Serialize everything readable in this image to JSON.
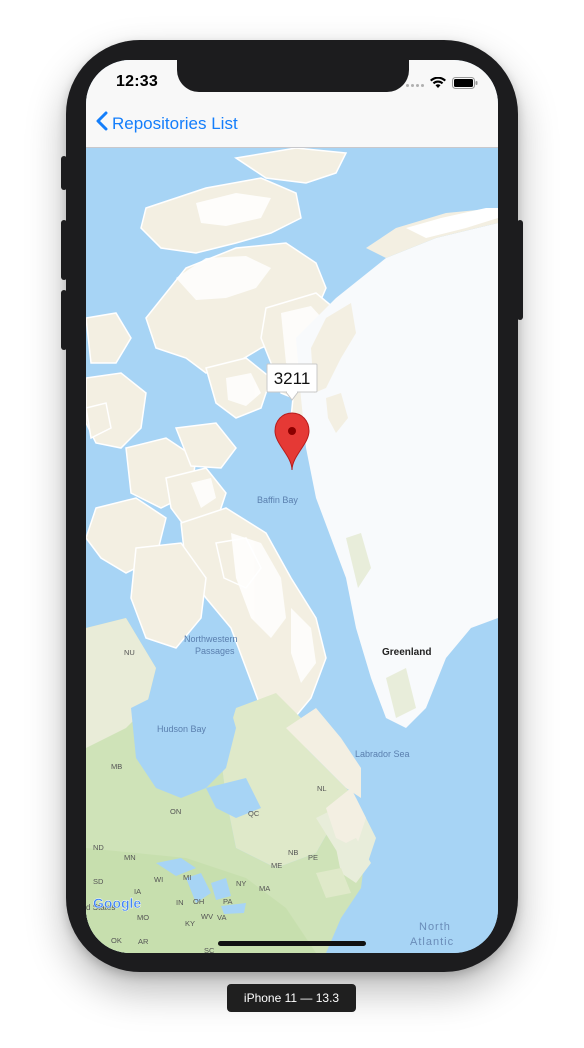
{
  "status_bar": {
    "time": "12:33"
  },
  "nav": {
    "back_label": "Repositories List"
  },
  "map": {
    "callout": "3211",
    "labels": {
      "baffin_bay": "Baffin Bay",
      "northwestern_1": "Northwestern",
      "northwestern_2": "Passages",
      "nu": "NU",
      "greenland": "Greenland",
      "hudson_bay": "Hudson Bay",
      "labrador_sea": "Labrador Sea",
      "mb": "MB",
      "on": "ON",
      "qc": "QC",
      "nl": "NL",
      "nd": "ND",
      "mn": "MN",
      "wi": "WI",
      "me": "ME",
      "nb": "NB",
      "pe": "PE",
      "sd": "SD",
      "ia": "IA",
      "mi": "MI",
      "ny": "NY",
      "ma": "MA",
      "in": "IN",
      "oh": "OH",
      "pa": "PA",
      "mo": "MO",
      "wv": "WV",
      "va": "VA",
      "ky": "KY",
      "ok": "OK",
      "ar": "AR",
      "sc": "SC",
      "states_fragment": "d States",
      "north_atlantic_1": "North",
      "north_atlantic_2": "Atlantic",
      "google": "Google"
    },
    "colors": {
      "water": "#a7d4f5",
      "land": "#f3efe2",
      "ice": "#f8fafc",
      "green": "#cfe3b8",
      "marker": "#e53935"
    }
  },
  "device": {
    "label": "iPhone 11 — 13.3"
  }
}
